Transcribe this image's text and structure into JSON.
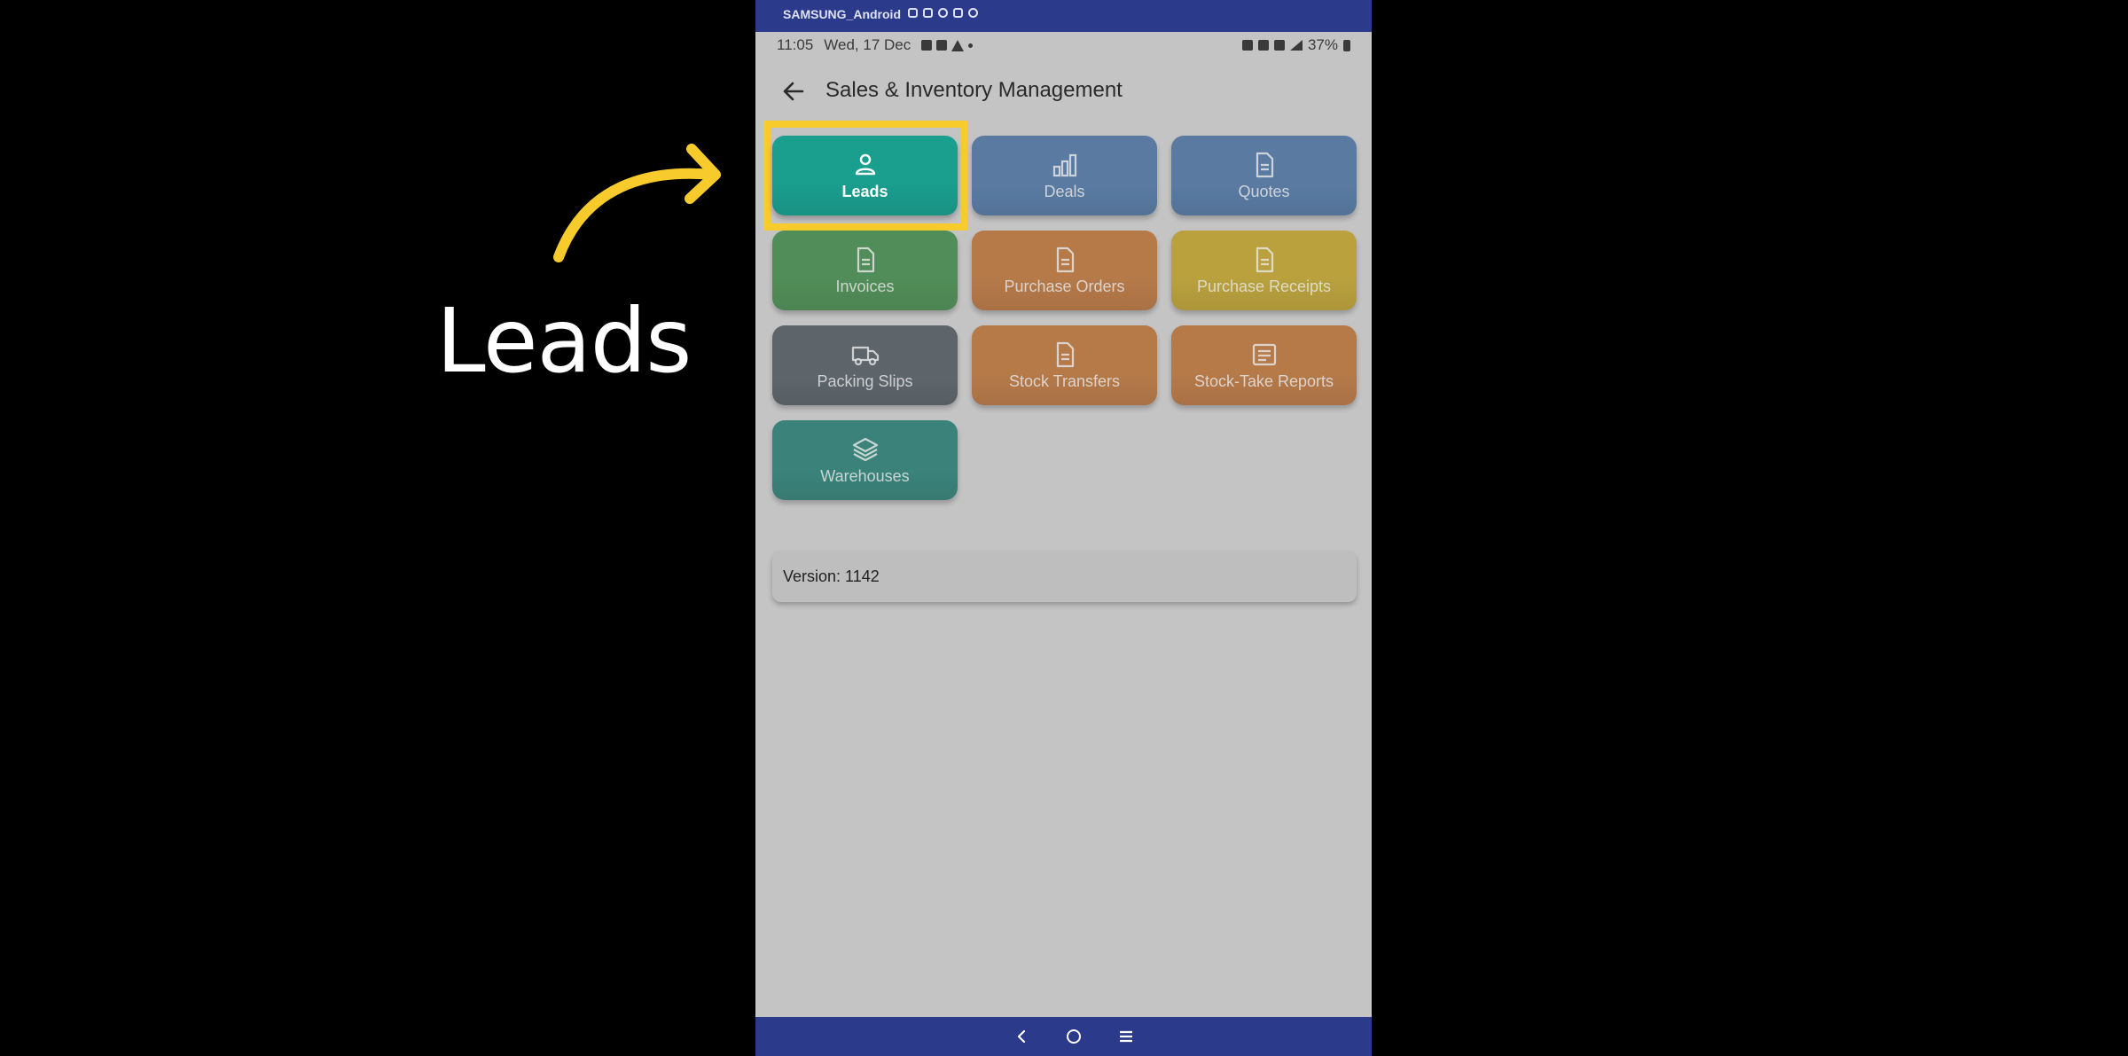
{
  "overlay": {
    "caption": "Leads",
    "arrow_color": "#f7cb2b"
  },
  "window": {
    "title": "SAMSUNG_Android",
    "tool_icons": [
      "camera-icon",
      "video-icon",
      "headset-icon",
      "fullscreen-icon",
      "gear-icon"
    ]
  },
  "status_bar": {
    "time": "11:05",
    "date": "Wed, 17 Dec",
    "battery": "37%",
    "left_icons": [
      "link-icon",
      "sim-icon",
      "warning-icon",
      "dot-icon"
    ],
    "right_icons": [
      "mute-icon",
      "location-icon",
      "lte-icon",
      "signal-icon",
      "battery-icon"
    ]
  },
  "app_bar": {
    "title": "Sales & Inventory Management",
    "back_icon": "arrow-left-icon"
  },
  "tiles": [
    {
      "label": "Leads",
      "icon": "person-icon",
      "color": "#1a9e8e",
      "active": true
    },
    {
      "label": "Deals",
      "icon": "bar-chart-icon",
      "color": "#4a7fbf",
      "active": false
    },
    {
      "label": "Quotes",
      "icon": "document-icon",
      "color": "#4a7fbf",
      "active": false
    },
    {
      "label": "Invoices",
      "icon": "document-icon",
      "color": "#3a9a45",
      "active": false
    },
    {
      "label": "Purchase Orders",
      "icon": "document-icon",
      "color": "#d9782a",
      "active": false
    },
    {
      "label": "Purchase Receipts",
      "icon": "document-icon",
      "color": "#d4ac0d",
      "active": false
    },
    {
      "label": "Packing Slips",
      "icon": "truck-icon",
      "color": "#56646e",
      "active": false
    },
    {
      "label": "Stock Transfers",
      "icon": "document-icon",
      "color": "#d9782a",
      "active": false
    },
    {
      "label": "Stock-Take Reports",
      "icon": "checklist-icon",
      "color": "#d9782a",
      "active": false
    },
    {
      "label": "Warehouses",
      "icon": "layers-icon",
      "color": "#1a8e80",
      "active": false
    }
  ],
  "version": {
    "text": "Version: 1142"
  },
  "nav_bar": {
    "back": "chevron-left-icon",
    "home": "home-circle-icon",
    "recents": "menu-lines-icon"
  }
}
